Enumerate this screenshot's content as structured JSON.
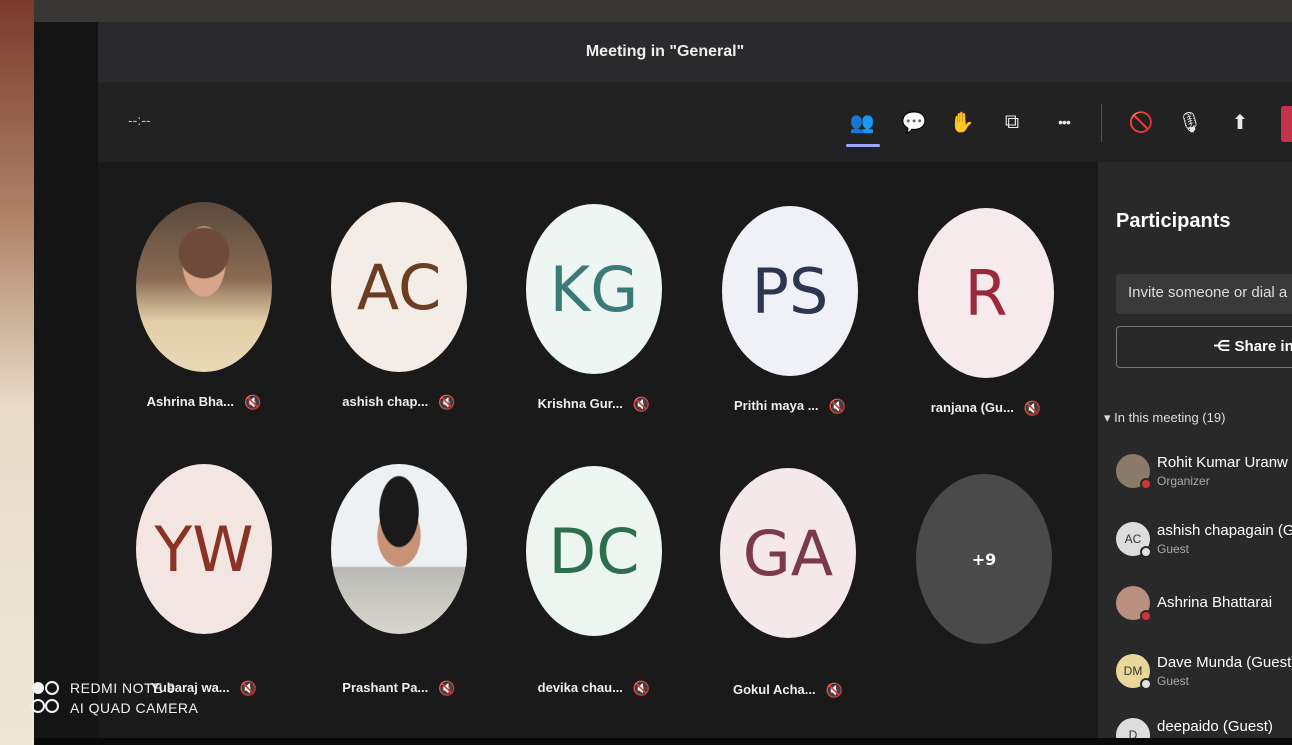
{
  "window": {
    "title": "Meeting in \"General\""
  },
  "toolbar": {
    "timer": "--:--",
    "icons": [
      "people-icon",
      "chat-icon",
      "raise-hand-icon",
      "rooms-icon",
      "more-icon",
      "camera-off-icon",
      "mic-icon",
      "share-tray-icon"
    ],
    "glyphs": {
      "people": "👥",
      "chat": "💬",
      "hand": "✋",
      "rooms": "⧉",
      "more": "•••",
      "camera": "🚫",
      "mic": "🎙",
      "share": "⬆"
    }
  },
  "stage": {
    "tiles": [
      {
        "name": "Ashrina Bha...",
        "initials": "",
        "photo": true
      },
      {
        "name": "ashish chap...",
        "initials": "AC",
        "fg": "#6b3e22",
        "bg": "#f4ece6"
      },
      {
        "name": "Krishna Gur...",
        "initials": "KG",
        "fg": "#3c7a78",
        "bg": "#eef6f4"
      },
      {
        "name": "Prithi maya ...",
        "initials": "PS",
        "fg": "#2e3550",
        "bg": "#f0f1f6"
      },
      {
        "name": "ranjana (Gu...",
        "initials": "R",
        "fg": "#9a2a3a",
        "bg": "#f6eaec"
      },
      {
        "name": "Yubaraj wa...",
        "initials": "YW",
        "fg": "#8a3322",
        "bg": "#f3e6e2"
      },
      {
        "name": "Prashant Pa...",
        "initials": "",
        "photo": true
      },
      {
        "name": "devika chau...",
        "initials": "DC",
        "fg": "#2c6e4e",
        "bg": "#ecf5ef"
      },
      {
        "name": "Gokul Acha...",
        "initials": "GA",
        "fg": "#7a3a4a",
        "bg": "#f4e8ea"
      }
    ],
    "overflow_label": "+9",
    "mute_glyph": "🔇"
  },
  "panel": {
    "title": "Participants",
    "invite_placeholder": "Invite someone or dial a n",
    "share_label": "Share inv",
    "share_glyph": "⋲",
    "section_label": "▾  In this meeting (19)",
    "participants": [
      {
        "name": "Rohit Kumar Uranw",
        "role": "Organizer",
        "initials": ""
      },
      {
        "name": "ashish chapagain (Gu",
        "role": "Guest",
        "initials": "AC"
      },
      {
        "name": "Ashrina Bhattarai",
        "role": "",
        "initials": ""
      },
      {
        "name": "Dave Munda (Guest)",
        "role": "Guest",
        "initials": "DM"
      },
      {
        "name": "deepaido (Guest)",
        "role": "Guest",
        "initials": "D"
      }
    ],
    "colors": {
      "busy": "#d13438",
      "away": "#e0e0e0",
      "dm_bg": "#e9d79a"
    }
  },
  "watermark": {
    "line1": "REDMI NOTE 9",
    "line2": "AI QUAD CAMERA"
  }
}
